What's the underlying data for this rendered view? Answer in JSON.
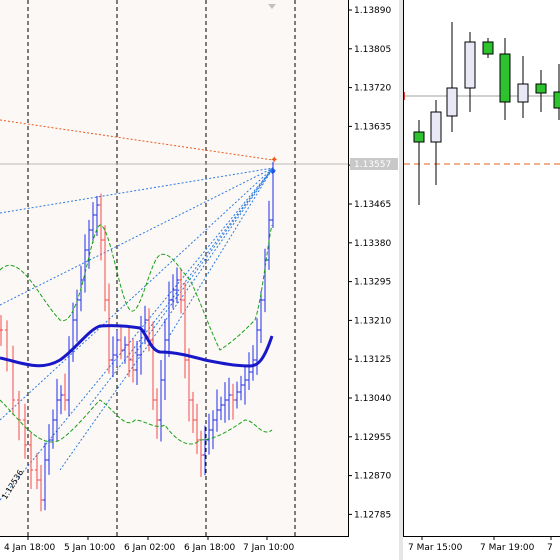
{
  "left_chart": {
    "price_axis": [
      "1.13890",
      "1.13805",
      "1.13720",
      "1.13635",
      "1.13550",
      "1.13465",
      "1.13380",
      "1.13295",
      "1.13210",
      "1.13125",
      "1.13040",
      "1.12955",
      "1.12870",
      "1.12785"
    ],
    "price_marker": "1.13557",
    "time_axis": [
      "4 Jan 18:00",
      "5 Jan 10:00",
      "6 Jan 02:00",
      "6 Jan 18:00",
      "7 Jan 10:00"
    ],
    "fib_label": "1.12536",
    "colors": {
      "bull_bar": "#1e2ee8",
      "bear_bar": "#f24a4a",
      "moving_average": "#1818c8",
      "envelope": "#18a018",
      "fan_lines": "#2a7be0",
      "orange_line": "#e85a1a",
      "background": "#fcf8f5"
    }
  },
  "right_chart": {
    "time_axis": [
      "7 Mar 15:00",
      "7 Mar 19:00",
      "7"
    ],
    "colors": {
      "bull_candle": "#e8e8f6",
      "bear_candle": "#2fc22f",
      "dashed_level": "#e8601a",
      "grey_level": "#a0a0a0"
    }
  }
}
